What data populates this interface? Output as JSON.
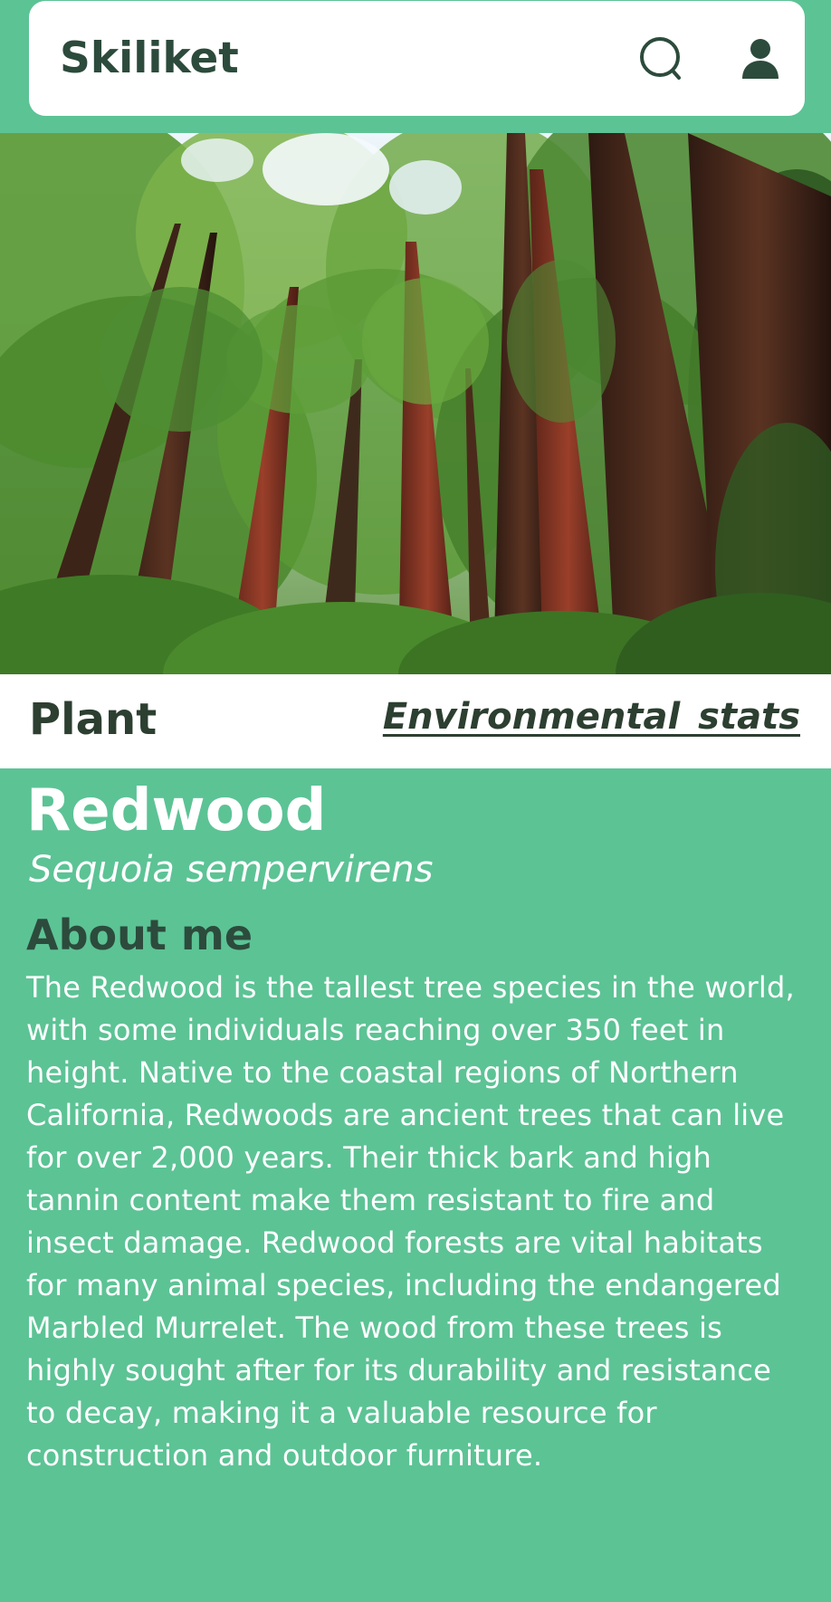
{
  "header": {
    "app_title": "Skiliket",
    "search_icon": "search-icon",
    "user_icon": "user-icon"
  },
  "hero": {
    "image_subject": "redwood-forest"
  },
  "tabs": {
    "plant_label": "Plant",
    "env_stats_label": "Environmental  stats"
  },
  "plant": {
    "name": "Redwood",
    "scientific_name": "Sequoia sempervirens",
    "about_heading": "About me",
    "about_text": "The Redwood is the tallest tree species in the world, with some individuals reaching over 350 feet in height. Native to the coastal regions of Northern California, Redwoods are ancient trees that can live for over 2,000 years. Their thick bark and high tannin content make them resistant to fire and insect damage. Redwood forests are vital habitats for many animal species, including the endangered Marbled Murrelet. The wood from these trees is highly sought after for its durability and resistance to decay, making it a valuable resource for construction and outdoor furniture."
  },
  "colors": {
    "background": "#5cc395",
    "header_text": "#2c4b3c",
    "tab_text": "#2c3f30",
    "body_text": "#ffffff"
  }
}
